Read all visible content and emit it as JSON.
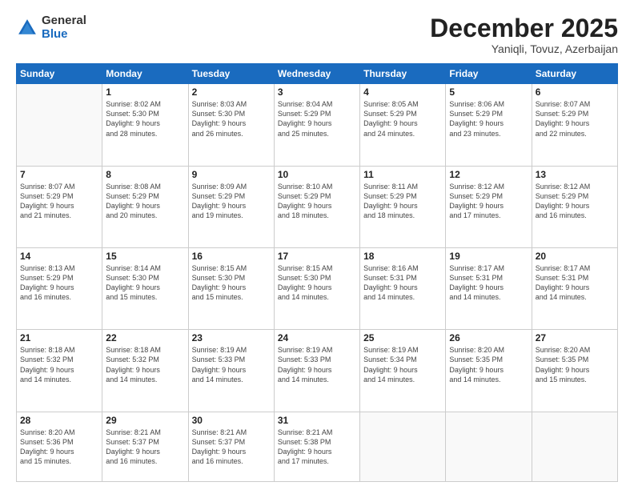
{
  "logo": {
    "general": "General",
    "blue": "Blue"
  },
  "header": {
    "month": "December 2025",
    "location": "Yaniqli, Tovuz, Azerbaijan"
  },
  "weekdays": [
    "Sunday",
    "Monday",
    "Tuesday",
    "Wednesday",
    "Thursday",
    "Friday",
    "Saturday"
  ],
  "weeks": [
    [
      {
        "day": "",
        "info": ""
      },
      {
        "day": "1",
        "info": "Sunrise: 8:02 AM\nSunset: 5:30 PM\nDaylight: 9 hours\nand 28 minutes."
      },
      {
        "day": "2",
        "info": "Sunrise: 8:03 AM\nSunset: 5:30 PM\nDaylight: 9 hours\nand 26 minutes."
      },
      {
        "day": "3",
        "info": "Sunrise: 8:04 AM\nSunset: 5:29 PM\nDaylight: 9 hours\nand 25 minutes."
      },
      {
        "day": "4",
        "info": "Sunrise: 8:05 AM\nSunset: 5:29 PM\nDaylight: 9 hours\nand 24 minutes."
      },
      {
        "day": "5",
        "info": "Sunrise: 8:06 AM\nSunset: 5:29 PM\nDaylight: 9 hours\nand 23 minutes."
      },
      {
        "day": "6",
        "info": "Sunrise: 8:07 AM\nSunset: 5:29 PM\nDaylight: 9 hours\nand 22 minutes."
      }
    ],
    [
      {
        "day": "7",
        "info": "Sunrise: 8:07 AM\nSunset: 5:29 PM\nDaylight: 9 hours\nand 21 minutes."
      },
      {
        "day": "8",
        "info": "Sunrise: 8:08 AM\nSunset: 5:29 PM\nDaylight: 9 hours\nand 20 minutes."
      },
      {
        "day": "9",
        "info": "Sunrise: 8:09 AM\nSunset: 5:29 PM\nDaylight: 9 hours\nand 19 minutes."
      },
      {
        "day": "10",
        "info": "Sunrise: 8:10 AM\nSunset: 5:29 PM\nDaylight: 9 hours\nand 18 minutes."
      },
      {
        "day": "11",
        "info": "Sunrise: 8:11 AM\nSunset: 5:29 PM\nDaylight: 9 hours\nand 18 minutes."
      },
      {
        "day": "12",
        "info": "Sunrise: 8:12 AM\nSunset: 5:29 PM\nDaylight: 9 hours\nand 17 minutes."
      },
      {
        "day": "13",
        "info": "Sunrise: 8:12 AM\nSunset: 5:29 PM\nDaylight: 9 hours\nand 16 minutes."
      }
    ],
    [
      {
        "day": "14",
        "info": "Sunrise: 8:13 AM\nSunset: 5:29 PM\nDaylight: 9 hours\nand 16 minutes."
      },
      {
        "day": "15",
        "info": "Sunrise: 8:14 AM\nSunset: 5:30 PM\nDaylight: 9 hours\nand 15 minutes."
      },
      {
        "day": "16",
        "info": "Sunrise: 8:15 AM\nSunset: 5:30 PM\nDaylight: 9 hours\nand 15 minutes."
      },
      {
        "day": "17",
        "info": "Sunrise: 8:15 AM\nSunset: 5:30 PM\nDaylight: 9 hours\nand 14 minutes."
      },
      {
        "day": "18",
        "info": "Sunrise: 8:16 AM\nSunset: 5:31 PM\nDaylight: 9 hours\nand 14 minutes."
      },
      {
        "day": "19",
        "info": "Sunrise: 8:17 AM\nSunset: 5:31 PM\nDaylight: 9 hours\nand 14 minutes."
      },
      {
        "day": "20",
        "info": "Sunrise: 8:17 AM\nSunset: 5:31 PM\nDaylight: 9 hours\nand 14 minutes."
      }
    ],
    [
      {
        "day": "21",
        "info": "Sunrise: 8:18 AM\nSunset: 5:32 PM\nDaylight: 9 hours\nand 14 minutes."
      },
      {
        "day": "22",
        "info": "Sunrise: 8:18 AM\nSunset: 5:32 PM\nDaylight: 9 hours\nand 14 minutes."
      },
      {
        "day": "23",
        "info": "Sunrise: 8:19 AM\nSunset: 5:33 PM\nDaylight: 9 hours\nand 14 minutes."
      },
      {
        "day": "24",
        "info": "Sunrise: 8:19 AM\nSunset: 5:33 PM\nDaylight: 9 hours\nand 14 minutes."
      },
      {
        "day": "25",
        "info": "Sunrise: 8:19 AM\nSunset: 5:34 PM\nDaylight: 9 hours\nand 14 minutes."
      },
      {
        "day": "26",
        "info": "Sunrise: 8:20 AM\nSunset: 5:35 PM\nDaylight: 9 hours\nand 14 minutes."
      },
      {
        "day": "27",
        "info": "Sunrise: 8:20 AM\nSunset: 5:35 PM\nDaylight: 9 hours\nand 15 minutes."
      }
    ],
    [
      {
        "day": "28",
        "info": "Sunrise: 8:20 AM\nSunset: 5:36 PM\nDaylight: 9 hours\nand 15 minutes."
      },
      {
        "day": "29",
        "info": "Sunrise: 8:21 AM\nSunset: 5:37 PM\nDaylight: 9 hours\nand 16 minutes."
      },
      {
        "day": "30",
        "info": "Sunrise: 8:21 AM\nSunset: 5:37 PM\nDaylight: 9 hours\nand 16 minutes."
      },
      {
        "day": "31",
        "info": "Sunrise: 8:21 AM\nSunset: 5:38 PM\nDaylight: 9 hours\nand 17 minutes."
      },
      {
        "day": "",
        "info": ""
      },
      {
        "day": "",
        "info": ""
      },
      {
        "day": "",
        "info": ""
      }
    ]
  ]
}
